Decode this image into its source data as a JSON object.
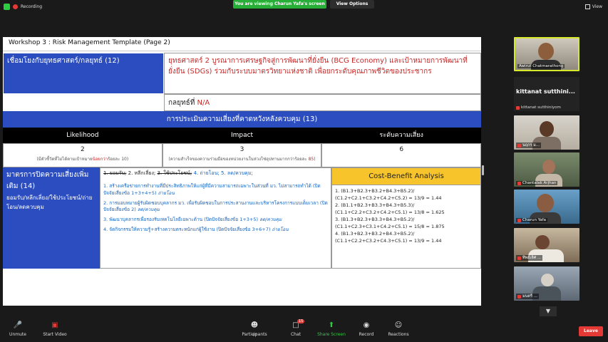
{
  "topbar": {
    "recording_label": "Recording",
    "viewing_banner": "You are viewing Charun Yafa's screen",
    "view_options": "View Options",
    "view_button": "View"
  },
  "slide": {
    "title": "Workshop 3 : Risk Management Template (Page 2)",
    "link_label": "เชื่อมโยงกับยุทธศาสตร์/กลยุทธ์ (12)",
    "strategy_text": "ยุทธศาสตร์ 2 บูรณาการเศรษฐกิจสู่การพัฒนาที่ยั่งยืน (BCG Economy) และเป้าหมายการพัฒนาที่ยั่งยืน (SDGs) ร่วมกับระบบมาตรวิทยาแห่งชาติ เพื่อยกระดับคุณภาพชีวิตของประชากร",
    "tactic_label": "กลยุทธ์ที่",
    "tactic_value": "N/A",
    "assessment_title": "การประเมินความเสี่ยงที่คาดหวังหลังควบคุม (13)",
    "headers": {
      "likelihood": "Likelihood",
      "impact": "Impact",
      "level": "ระดับความเสี่ยง"
    },
    "values": {
      "likelihood": "2",
      "impact": "3",
      "level": "6"
    },
    "likelihood_note_pre": "(มีตัวชี้วัดที่ไม่ได้ตามเป้าหมาย",
    "likelihood_note_red": "น้อยกว่า",
    "likelihood_note_post": "ร้อยละ 10)",
    "impact_note_pre": "(ความสำเร็จของความร่วมมือของหน่วยงานในห่วงโซ่อุปทานมากกว่าร้อยละ ",
    "impact_note_red": "85",
    "impact_note_post": ")",
    "measure_label": "มาตรการปิดความเสี่ยงเพิ่มเติม (14)",
    "measure_sub": "ยอมรับ/หลีกเลี่ยง/ใช้ประโยชน์/ถ่ายโอน/ลดควบคุม",
    "options": {
      "o1": "1. ยอมรับ;",
      "o2": "2. หลีกเลี่ยง;",
      "o3": "3. ใช้ประโยชน์;",
      "o4": "4. ถ่ายโอน;",
      "o5": "5. ลด/ควบคุม;"
    },
    "actions": [
      {
        "text": "1. สร้างเครือข่ายการทำงานที่มีประสิทธิภาพให้แก่ผู้ที่มีความสามารถเฉพาะในส่วนที่ มว. ไม่สามารถทำได้ (ปิดปัจจัยเสี่ยงข้อ 1+3+4+5)",
        "tag": "ถ่ายโอน"
      },
      {
        "text": "2. การมอบหมายผู้รับผิดชอบบุคลากร มว. เพื่อรับผิดชอบในการประสานงานและบริหารโครงการแบบเต็มเวลา (ปิดปัจจัยเสี่ยงข้อ 2)",
        "tag": "ลด/ควบคุม"
      },
      {
        "text": "3. พัฒนาบุคลากรเพื่อรองรับเทคโนโลยีเฉพาะด้าน (ปิดปัจจัยเสี่ยงข้อ 1+3+5)",
        "tag": "ลด/ควบคุม"
      },
      {
        "text": "4. จัดกิจกรรมให้ความรู้+สร้างความตระหนักแก่ผู้ใช้งาน (ปิดปัจจัยเสี่ยงข้อ 3+6+7)",
        "tag": "ถ่ายโอน"
      }
    ],
    "cba_title": "Cost-Benefit Analysis",
    "cba_lines": [
      "1. (B1.3+B2.3+B3.2+B4.3+B5.2)/",
      "(C1.2+C2.1+C3.2+C4.2+C5.2) = 13/9 = 1.44",
      "2. (B1.1+B2.3+B3.3+B4.3+B5.3)/",
      "(C1.1+C2.2+C3.2+C4.2+C5.1) = 13/8 = 1.625",
      "3. (B1.3+B2.3+B3.3+B4.3+B5.2)/",
      "(C1.1+C2.3+C3.1+C4.2+C5.1) = 15/8 = 1.875",
      "4. (B1.3+B2.3+B3.2+B4.3+B5.2)/",
      "(C1.1+C2.2+C3.2+C4.3+C5.1) = 13/9 = 1.44"
    ]
  },
  "participants": [
    {
      "name": "Awirut Chatmarathong",
      "type": "video"
    },
    {
      "big": "kittanat sutthini...",
      "name": "kittanat sutthiniyom",
      "type": "name"
    },
    {
      "name": "นฤกร ม...",
      "type": "video"
    },
    {
      "name": "Chantalak Arjhan",
      "type": "video"
    },
    {
      "name": "Charun Yafa",
      "type": "video"
    },
    {
      "name": "ทิพย์เลิศ ...",
      "type": "video"
    },
    {
      "name": "มนตรี ...",
      "type": "video"
    }
  ],
  "toolbar": {
    "unmute": "Unmute",
    "start_video": "Start Video",
    "participants": "Participants",
    "participants_count": "47",
    "chat": "Chat",
    "chat_badge": "15",
    "share": "Share Screen",
    "record": "Record",
    "reactions": "Reactions",
    "leave": "Leave"
  }
}
